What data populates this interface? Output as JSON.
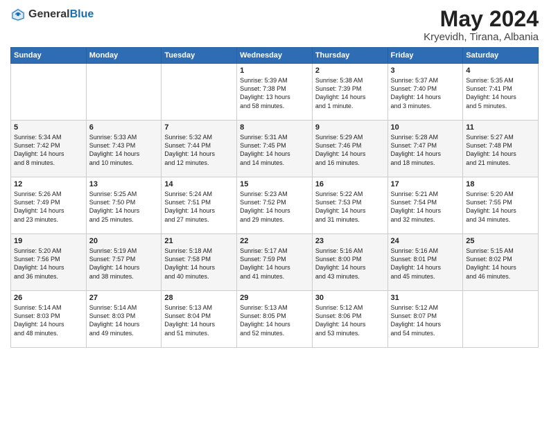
{
  "header": {
    "logo_general": "General",
    "logo_blue": "Blue",
    "month": "May 2024",
    "location": "Kryevidh, Tirana, Albania"
  },
  "weekdays": [
    "Sunday",
    "Monday",
    "Tuesday",
    "Wednesday",
    "Thursday",
    "Friday",
    "Saturday"
  ],
  "weeks": [
    [
      {
        "day": "",
        "text": ""
      },
      {
        "day": "",
        "text": ""
      },
      {
        "day": "",
        "text": ""
      },
      {
        "day": "1",
        "text": "Sunrise: 5:39 AM\nSunset: 7:38 PM\nDaylight: 13 hours\nand 58 minutes."
      },
      {
        "day": "2",
        "text": "Sunrise: 5:38 AM\nSunset: 7:39 PM\nDaylight: 14 hours\nand 1 minute."
      },
      {
        "day": "3",
        "text": "Sunrise: 5:37 AM\nSunset: 7:40 PM\nDaylight: 14 hours\nand 3 minutes."
      },
      {
        "day": "4",
        "text": "Sunrise: 5:35 AM\nSunset: 7:41 PM\nDaylight: 14 hours\nand 5 minutes."
      }
    ],
    [
      {
        "day": "5",
        "text": "Sunrise: 5:34 AM\nSunset: 7:42 PM\nDaylight: 14 hours\nand 8 minutes."
      },
      {
        "day": "6",
        "text": "Sunrise: 5:33 AM\nSunset: 7:43 PM\nDaylight: 14 hours\nand 10 minutes."
      },
      {
        "day": "7",
        "text": "Sunrise: 5:32 AM\nSunset: 7:44 PM\nDaylight: 14 hours\nand 12 minutes."
      },
      {
        "day": "8",
        "text": "Sunrise: 5:31 AM\nSunset: 7:45 PM\nDaylight: 14 hours\nand 14 minutes."
      },
      {
        "day": "9",
        "text": "Sunrise: 5:29 AM\nSunset: 7:46 PM\nDaylight: 14 hours\nand 16 minutes."
      },
      {
        "day": "10",
        "text": "Sunrise: 5:28 AM\nSunset: 7:47 PM\nDaylight: 14 hours\nand 18 minutes."
      },
      {
        "day": "11",
        "text": "Sunrise: 5:27 AM\nSunset: 7:48 PM\nDaylight: 14 hours\nand 21 minutes."
      }
    ],
    [
      {
        "day": "12",
        "text": "Sunrise: 5:26 AM\nSunset: 7:49 PM\nDaylight: 14 hours\nand 23 minutes."
      },
      {
        "day": "13",
        "text": "Sunrise: 5:25 AM\nSunset: 7:50 PM\nDaylight: 14 hours\nand 25 minutes."
      },
      {
        "day": "14",
        "text": "Sunrise: 5:24 AM\nSunset: 7:51 PM\nDaylight: 14 hours\nand 27 minutes."
      },
      {
        "day": "15",
        "text": "Sunrise: 5:23 AM\nSunset: 7:52 PM\nDaylight: 14 hours\nand 29 minutes."
      },
      {
        "day": "16",
        "text": "Sunrise: 5:22 AM\nSunset: 7:53 PM\nDaylight: 14 hours\nand 31 minutes."
      },
      {
        "day": "17",
        "text": "Sunrise: 5:21 AM\nSunset: 7:54 PM\nDaylight: 14 hours\nand 32 minutes."
      },
      {
        "day": "18",
        "text": "Sunrise: 5:20 AM\nSunset: 7:55 PM\nDaylight: 14 hours\nand 34 minutes."
      }
    ],
    [
      {
        "day": "19",
        "text": "Sunrise: 5:20 AM\nSunset: 7:56 PM\nDaylight: 14 hours\nand 36 minutes."
      },
      {
        "day": "20",
        "text": "Sunrise: 5:19 AM\nSunset: 7:57 PM\nDaylight: 14 hours\nand 38 minutes."
      },
      {
        "day": "21",
        "text": "Sunrise: 5:18 AM\nSunset: 7:58 PM\nDaylight: 14 hours\nand 40 minutes."
      },
      {
        "day": "22",
        "text": "Sunrise: 5:17 AM\nSunset: 7:59 PM\nDaylight: 14 hours\nand 41 minutes."
      },
      {
        "day": "23",
        "text": "Sunrise: 5:16 AM\nSunset: 8:00 PM\nDaylight: 14 hours\nand 43 minutes."
      },
      {
        "day": "24",
        "text": "Sunrise: 5:16 AM\nSunset: 8:01 PM\nDaylight: 14 hours\nand 45 minutes."
      },
      {
        "day": "25",
        "text": "Sunrise: 5:15 AM\nSunset: 8:02 PM\nDaylight: 14 hours\nand 46 minutes."
      }
    ],
    [
      {
        "day": "26",
        "text": "Sunrise: 5:14 AM\nSunset: 8:03 PM\nDaylight: 14 hours\nand 48 minutes."
      },
      {
        "day": "27",
        "text": "Sunrise: 5:14 AM\nSunset: 8:03 PM\nDaylight: 14 hours\nand 49 minutes."
      },
      {
        "day": "28",
        "text": "Sunrise: 5:13 AM\nSunset: 8:04 PM\nDaylight: 14 hours\nand 51 minutes."
      },
      {
        "day": "29",
        "text": "Sunrise: 5:13 AM\nSunset: 8:05 PM\nDaylight: 14 hours\nand 52 minutes."
      },
      {
        "day": "30",
        "text": "Sunrise: 5:12 AM\nSunset: 8:06 PM\nDaylight: 14 hours\nand 53 minutes."
      },
      {
        "day": "31",
        "text": "Sunrise: 5:12 AM\nSunset: 8:07 PM\nDaylight: 14 hours\nand 54 minutes."
      },
      {
        "day": "",
        "text": ""
      }
    ]
  ]
}
